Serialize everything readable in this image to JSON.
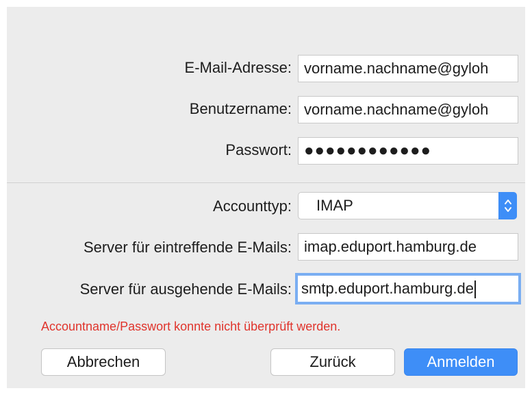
{
  "form": {
    "email_label": "E-Mail-Adresse:",
    "email_value": "vorname.nachname@gyloh",
    "username_label": "Benutzername:",
    "username_value": "vorname.nachname@gyloh",
    "password_label": "Passwort:",
    "password_value": "●●●●●●●●●●●●",
    "account_type_label": "Accounttyp:",
    "account_type_value": "IMAP",
    "incoming_label": "Server für eintreffende E-Mails:",
    "incoming_value": "imap.eduport.hamburg.de",
    "outgoing_label": "Server für ausgehende E-Mails:",
    "outgoing_value": "smtp.eduport.hamburg.de"
  },
  "error_message": "Accountname/Passwort konnte nicht überprüft werden.",
  "buttons": {
    "cancel": "Abbrechen",
    "back": "Zurück",
    "login": "Anmelden"
  },
  "colors": {
    "accent": "#3e8ef7",
    "error": "#e0342c",
    "focus_ring": "#7aaef2"
  },
  "icons": {
    "stepper": "chevron-up-down-icon"
  }
}
